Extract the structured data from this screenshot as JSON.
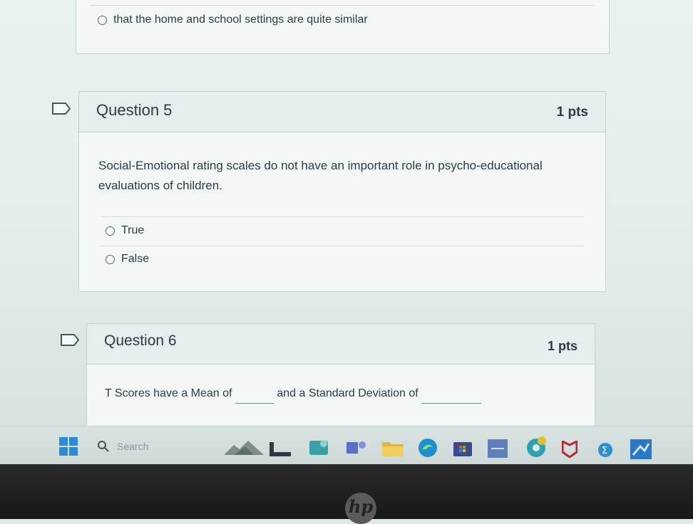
{
  "prev_question": {
    "answer_label": "that the home and school settings are quite similar"
  },
  "question5": {
    "title": "Question 5",
    "points": "1 pts",
    "text": "Social-Emotional rating scales do not have an important role in psycho-educational evaluations of children.",
    "answers": [
      {
        "label": "True"
      },
      {
        "label": "False"
      }
    ]
  },
  "question6": {
    "title": "Question 6",
    "points": "1 pts",
    "text_part1": "T Scores have a Mean of",
    "text_part2": "and a Standard Deviation of"
  },
  "taskbar": {
    "search_placeholder": "Search",
    "icons": [
      "windows-start-icon",
      "widgets-icon",
      "file-explorer-icon",
      "photos-icon",
      "teams-icon",
      "folder-icon",
      "edge-icon",
      "store-icon",
      "app-icon",
      "chrome-icon",
      "mcafee-icon",
      "calculator-icon",
      "app-icon-2"
    ]
  },
  "laptop": {
    "logo": "hp"
  }
}
